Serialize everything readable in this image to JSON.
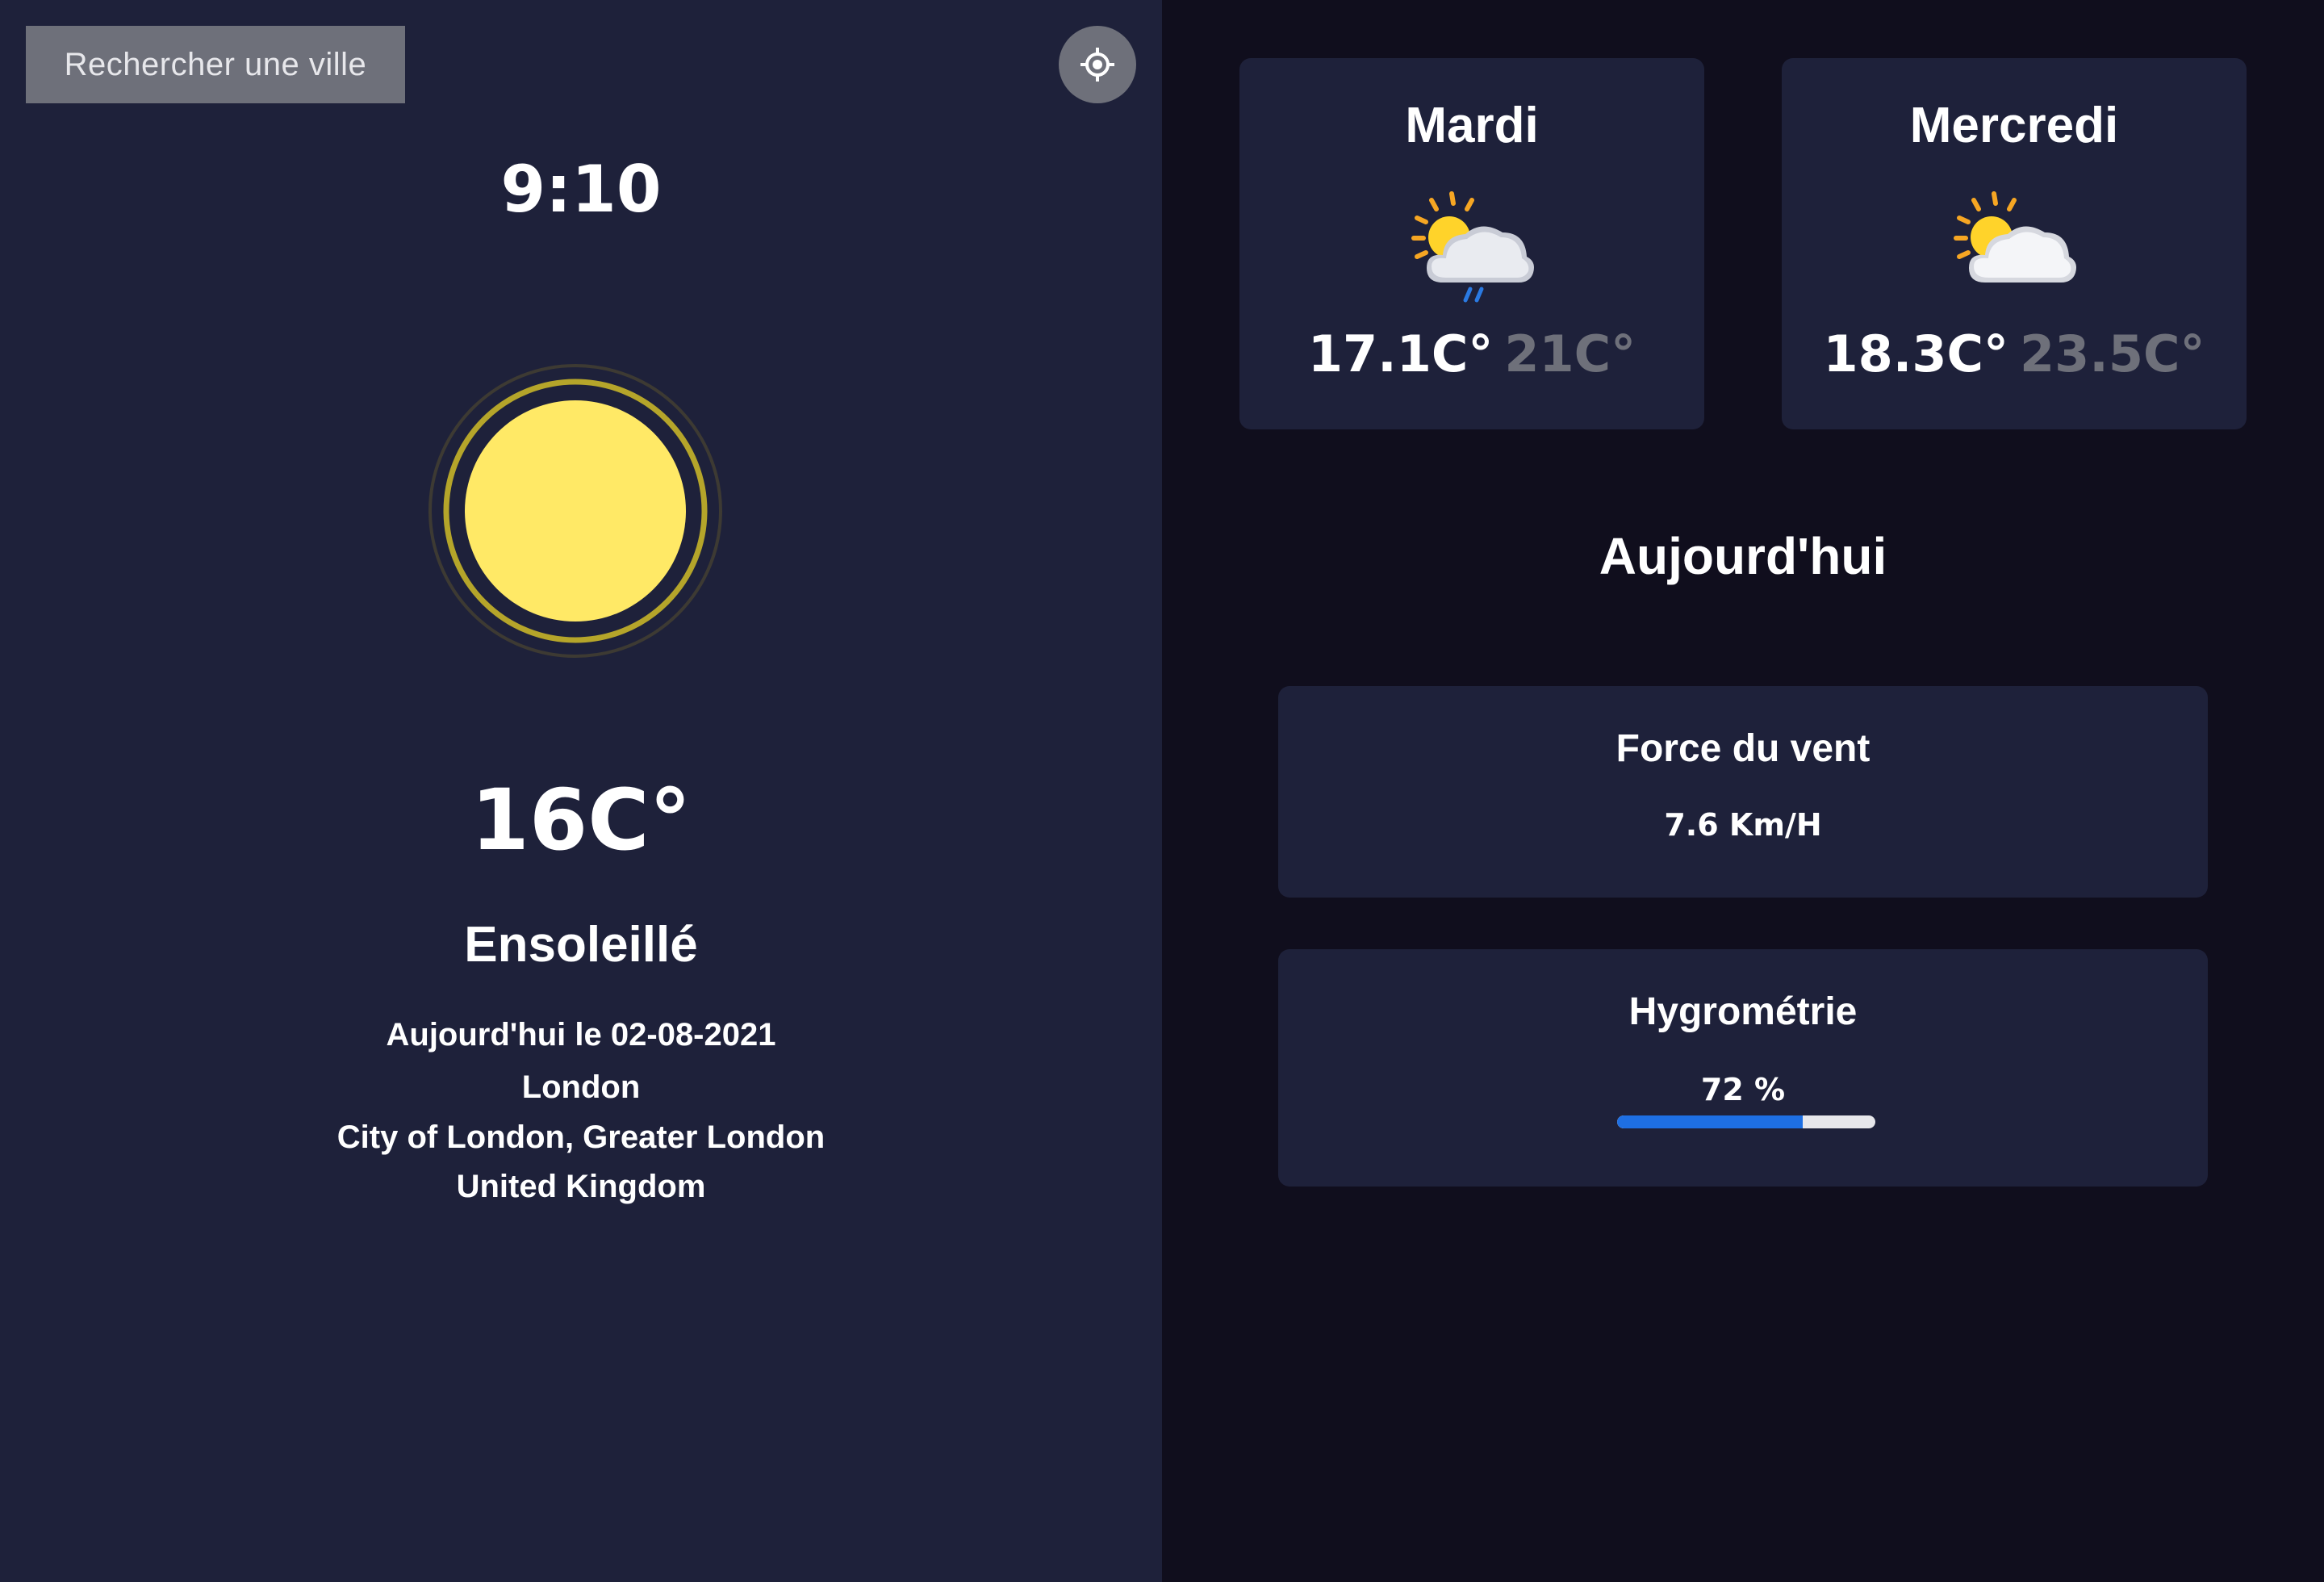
{
  "sidebar": {
    "search_label": "Rechercher une ville",
    "locate_icon": "crosshair-icon",
    "time": "9:10",
    "weather_icon": "sun-icon",
    "temperature": "16C°",
    "condition": "Ensoleillé",
    "date_line": "Aujourd'hui le 02-08-2021",
    "city": "London",
    "region": "City of London, Greater London",
    "country": "United Kingdom"
  },
  "forecast": [
    {
      "day": "Mardi",
      "icon": "sun-cloud-rain-icon",
      "min": "17.1C°",
      "max": "21C°"
    },
    {
      "day": "Mercredi",
      "icon": "sun-cloud-icon",
      "min": "18.3C°",
      "max": "23.5C°"
    }
  ],
  "today": {
    "title": "Aujourd'hui",
    "wind": {
      "title": "Force du vent",
      "value": "7.6 Km/H"
    },
    "humidity": {
      "title": "Hygrométrie",
      "value": "72 %",
      "percent": 72
    }
  },
  "colors": {
    "panel": "#1e213a",
    "background": "#100e1d",
    "button": "#6e707a",
    "sun": "#ffe966",
    "progress": "#1e6fe3"
  }
}
